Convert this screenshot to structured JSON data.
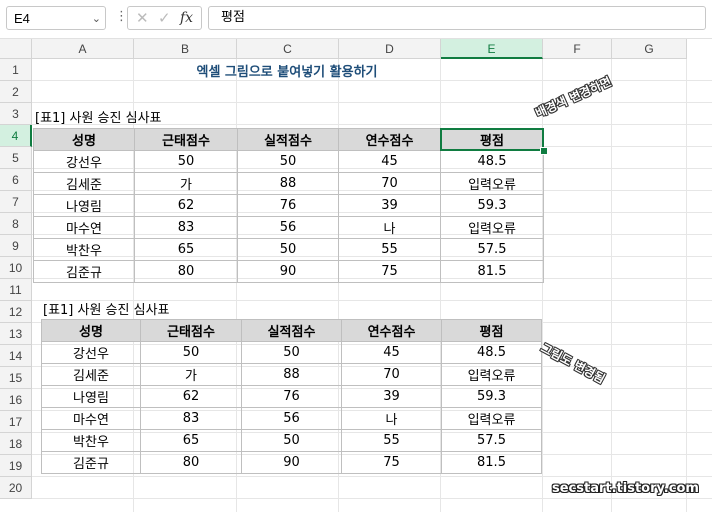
{
  "formula_bar": {
    "name_box": "E4",
    "formula": "평점",
    "cancel_icon": "x-icon",
    "enter_icon": "check-icon",
    "fx_label": "fx"
  },
  "columns": [
    "A",
    "B",
    "C",
    "D",
    "E",
    "F",
    "G"
  ],
  "rows": [
    "1",
    "2",
    "3",
    "4",
    "5",
    "6",
    "7",
    "8",
    "9",
    "10",
    "11",
    "12",
    "13",
    "14",
    "15",
    "16",
    "17",
    "18",
    "19",
    "20"
  ],
  "selected_cell": "E4",
  "title": "엑셀 그림으로 붙여넣기 활용하기",
  "table1": {
    "caption": "[표1] 사원 승진 심사표",
    "headers": [
      "성명",
      "근태점수",
      "실적점수",
      "연수점수",
      "평점"
    ],
    "rows": [
      [
        "강선우",
        "50",
        "50",
        "45",
        "48.5"
      ],
      [
        "김세준",
        "가",
        "88",
        "70",
        "입력오류"
      ],
      [
        "나영림",
        "62",
        "76",
        "39",
        "59.3"
      ],
      [
        "마수연",
        "83",
        "56",
        "나",
        "입력오류"
      ],
      [
        "박찬우",
        "65",
        "50",
        "55",
        "57.5"
      ],
      [
        "김준규",
        "80",
        "90",
        "75",
        "81.5"
      ]
    ]
  },
  "table2": {
    "caption": "[표1] 사원 승진 심사표",
    "headers": [
      "성명",
      "근태점수",
      "실적점수",
      "연수점수",
      "평점"
    ],
    "rows": [
      [
        "강선우",
        "50",
        "50",
        "45",
        "48.5"
      ],
      [
        "김세준",
        "가",
        "88",
        "70",
        "입력오류"
      ],
      [
        "나영림",
        "62",
        "76",
        "39",
        "59.3"
      ],
      [
        "마수연",
        "83",
        "56",
        "나",
        "입력오류"
      ],
      [
        "박찬우",
        "65",
        "50",
        "55",
        "57.5"
      ],
      [
        "김준규",
        "80",
        "90",
        "75",
        "81.5"
      ]
    ]
  },
  "annotations": {
    "note1": "배경색 변경하면",
    "note2": "그림도 변경됨",
    "watermark": "secstart.tistory.com"
  },
  "colors": {
    "highlight": "#ffff00",
    "header_fill": "#d9d9d9",
    "selection": "#107c41",
    "title": "#1f4e79"
  }
}
